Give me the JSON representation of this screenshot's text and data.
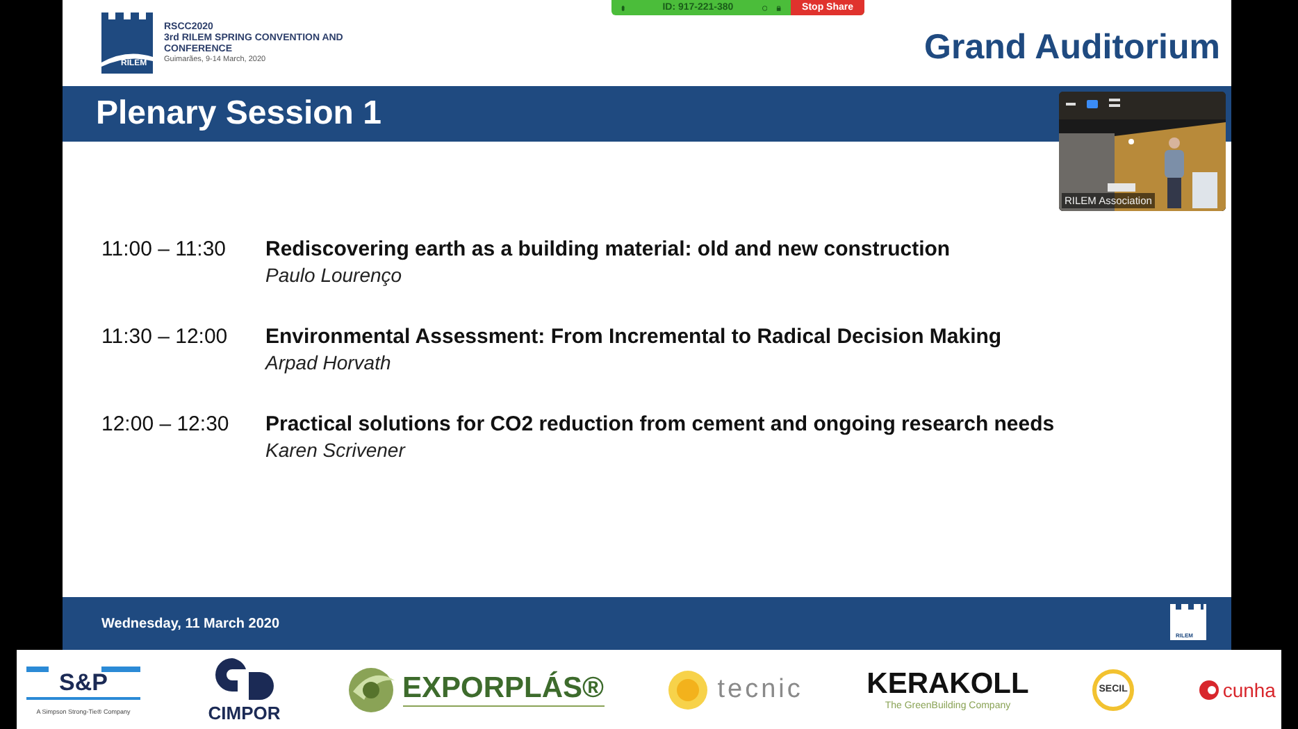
{
  "share_bar": {
    "meeting_id": "ID: 917-221-380",
    "stop_label": "Stop Share"
  },
  "slide": {
    "logo_mark": "RILEM",
    "event_code": "RSCC2020",
    "event_name": "3rd RILEM SPRING CONVENTION AND CONFERENCE",
    "event_place": "Guimarães, 9-14 March, 2020",
    "room": "Grand Auditorium",
    "session_title": "Plenary Session 1",
    "talks": [
      {
        "time": "11:00 – 11:30",
        "title": "Rediscovering earth as a building material: old and new construction",
        "speaker": "Paulo Lourenço"
      },
      {
        "time": "11:30 – 12:00",
        "title": "Environmental Assessment: From Incremental to Radical Decision Making",
        "speaker": "Arpad Horvath"
      },
      {
        "time": "12:00 – 12:30",
        "title": "Practical solutions for CO2 reduction from cement and ongoing research needs",
        "speaker": "Karen Scrivener"
      }
    ],
    "footer_date": "Wednesday, 11 March 2020",
    "footer_mark": "RILEM"
  },
  "video": {
    "participant": "RILEM Association"
  },
  "sponsors": [
    {
      "kind": "sp",
      "name": "S&P",
      "tagline": "A Simpson Strong-Tie® Company"
    },
    {
      "kind": "cimpor",
      "name": "CIMPOR"
    },
    {
      "kind": "exporplas",
      "name": "EXPORPLÁS®"
    },
    {
      "kind": "tecnic",
      "name": "tecnic"
    },
    {
      "kind": "kerakoll",
      "name": "KERAKOLL",
      "tagline": "The GreenBuilding Company"
    },
    {
      "kind": "secil",
      "name": "SECIL"
    },
    {
      "kind": "cunha",
      "name": "cunha"
    }
  ]
}
